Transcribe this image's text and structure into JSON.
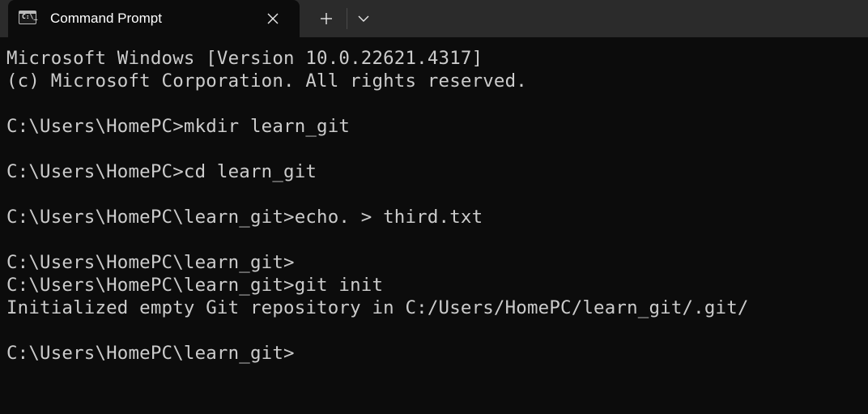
{
  "window": {
    "tab_title": "Command Prompt",
    "tab_icon": "cmd-icon",
    "tab_icon_text": "C:\\_",
    "close_icon": "close-icon",
    "new_tab_icon": "plus-icon",
    "dropdown_icon": "chevron-down-icon"
  },
  "terminal": {
    "lines": [
      "Microsoft Windows [Version 10.0.22621.4317]",
      "(c) Microsoft Corporation. All rights reserved.",
      "",
      "C:\\Users\\HomePC>mkdir learn_git",
      "",
      "C:\\Users\\HomePC>cd learn_git",
      "",
      "C:\\Users\\HomePC\\learn_git>echo. > third.txt",
      "",
      "C:\\Users\\HomePC\\learn_git>",
      "C:\\Users\\HomePC\\learn_git>git init",
      "Initialized empty Git repository in C:/Users/HomePC/learn_git/.git/",
      "",
      "C:\\Users\\HomePC\\learn_git>"
    ]
  },
  "colors": {
    "background": "#0c0c0c",
    "titlebar": "#2b2b2b",
    "text": "#cccccc"
  }
}
